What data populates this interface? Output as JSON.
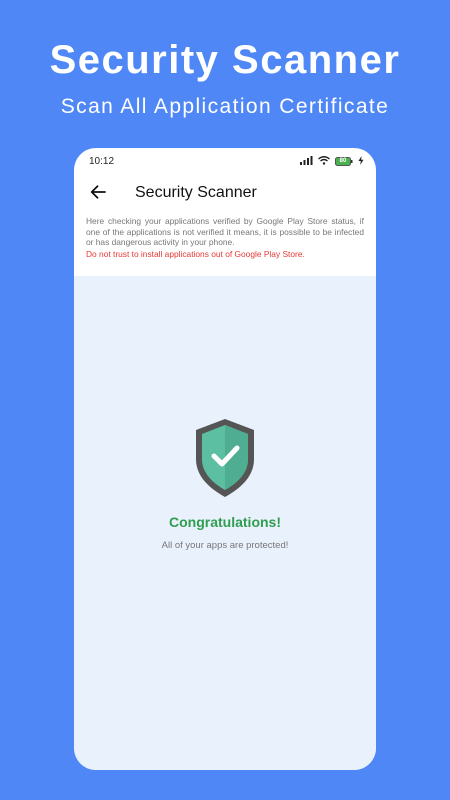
{
  "promo": {
    "title": "Security Scanner",
    "subtitle": "Scan All Application Certificate"
  },
  "status_bar": {
    "time": "10:12",
    "battery": "80",
    "icons": [
      "signal-icon",
      "wifi-icon",
      "battery-icon",
      "charging-icon"
    ]
  },
  "app_bar": {
    "back_icon": "back-arrow-icon",
    "title": "Security Scanner"
  },
  "info": {
    "description": "Here checking your applications verified by Google Play Store status, if one of the applications is not verified it means, it is possible to be infected or has dangerous activity in your phone.",
    "warning": "Do not trust to install applications out of Google Play Store."
  },
  "result": {
    "icon": "shield-check-icon",
    "title": "Congratulations!",
    "message": "All of your apps are protected!"
  },
  "colors": {
    "background": "#4f87f6",
    "content_background": "#e9f1fd",
    "success": "#2f9e4f",
    "warning": "#e53935",
    "shield": "#5dbfa2",
    "shield_border": "#555555"
  }
}
